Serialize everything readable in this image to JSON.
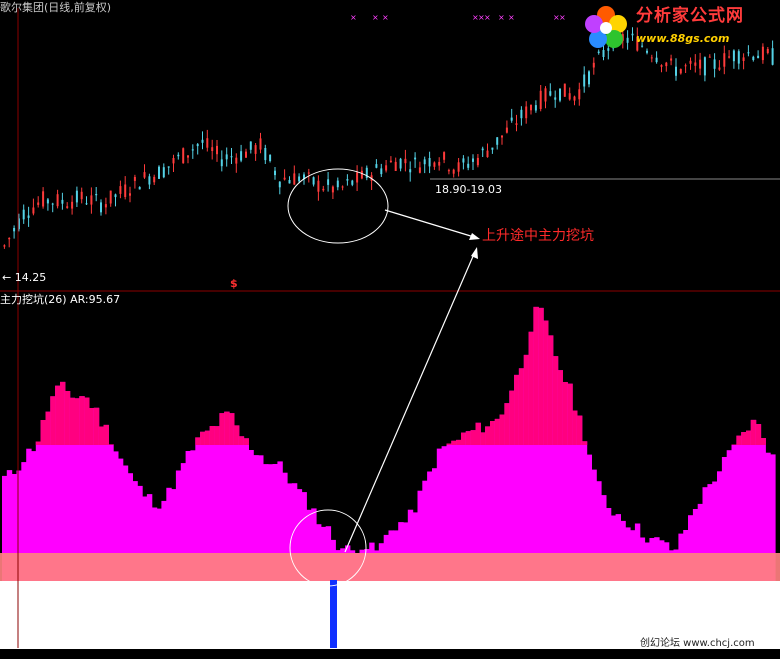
{
  "window": {
    "title": "歌尔集团(日线,前复权)",
    "indicator_title": "主力挖坑(26)  AR:95.67",
    "low_label": "← 14.25",
    "range_label": "18.90-19.03",
    "annotation": "上升途中主力挖坑",
    "dollar_marker": "$",
    "logo_text": "分析家公式网",
    "logo_url": "www.88gs.com",
    "watermark": "创幻论坛 www.chcj.com"
  },
  "colors": {
    "background": "#000000",
    "candle_up": "#ff3b3b",
    "candle_down": "#54d2e6",
    "bar_magenta": "#ff00ff",
    "bar_peak": "#ff0080",
    "band_salmon": "#ff8080",
    "band_white": "#ffffff",
    "dip_bar": "#1030ff",
    "separator": "#8b0000",
    "axis": "#8b0000"
  },
  "chart_data": [
    {
      "type": "candlestick",
      "title": "歌尔集团(日线,前复权)",
      "markers": [
        {
          "text": "← 14.25",
          "meaning": "period low"
        },
        {
          "text": "18.90-19.03",
          "meaning": "price range"
        }
      ],
      "annotation": "上升途中主力挖坑",
      "price_path": [
        14.25,
        15.9,
        16.5,
        16.4,
        16.6,
        16.3,
        16.9,
        17.5,
        17.9,
        18.6,
        19.3,
        18.5,
        18.7,
        19.1,
        17.5,
        17.6,
        17.2,
        17.0,
        17.5,
        18.0,
        18.4,
        18.2,
        18.6,
        18.0,
        18.5,
        19.3,
        20.3,
        21.2,
        21.8,
        21.5,
        23.0,
        24.4,
        24.2,
        23.6,
        22.8,
        22.9,
        23.0,
        23.5,
        23.6,
        23.4
      ],
      "candle_count": 160
    },
    {
      "type": "bar",
      "title": "主力挖坑(26)  AR:95.67",
      "series_count": 160,
      "profile": [
        75,
        78,
        86,
        95,
        103,
        110,
        130,
        150,
        162,
        165,
        160,
        155,
        158,
        152,
        142,
        130,
        120,
        105,
        93,
        82,
        70,
        62,
        55,
        52,
        50,
        57,
        70,
        82,
        95,
        105,
        115,
        120,
        125,
        132,
        138,
        135,
        120,
        112,
        105,
        100,
        93,
        90,
        88,
        82,
        72,
        63,
        55,
        48,
        35,
        28,
        20,
        10,
        5,
        2,
        1,
        10,
        5,
        2,
        8,
        20,
        28,
        30,
        32,
        45,
        60,
        75,
        90,
        102,
        108,
        110,
        115,
        120,
        122,
        125,
        128,
        130,
        135,
        150,
        165,
        180,
        200,
        230,
        245,
        230,
        210,
        190,
        175,
        160,
        140,
        120,
        95,
        70,
        55,
        45,
        40,
        35,
        30,
        25,
        20,
        15,
        12,
        10,
        5,
        3,
        15,
        30,
        45,
        55,
        65,
        75,
        85,
        95,
        105,
        115,
        125,
        130,
        125,
        110,
        95
      ]
    }
  ]
}
